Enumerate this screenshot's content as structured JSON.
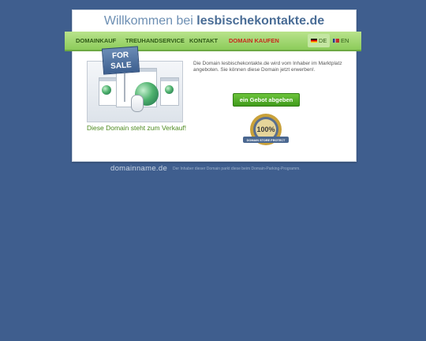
{
  "header": {
    "title_prefix": "Willkommen bei",
    "domain": "lesbischekontakte.de"
  },
  "nav": {
    "items": [
      {
        "label": "Domainkauf"
      },
      {
        "label": "Treuhandservice"
      },
      {
        "label": "Kontakt"
      },
      {
        "label": "Domain kaufen"
      }
    ],
    "languages": [
      {
        "code": "DE",
        "active": true
      },
      {
        "code": "EN",
        "active": false
      }
    ]
  },
  "sale": {
    "sign_line1": "FOR",
    "sign_line2": "SALE",
    "caption": "Diese Domain steht zum Verkauf!"
  },
  "info": {
    "text": "Die Domain lesbischekontakte.de wird vom Inhaber im Marktplatz angeboten. Sie können diese Domain jetzt erwerben!."
  },
  "bid_button": {
    "label": "ein Gebot abgeben"
  },
  "seal": {
    "big": "100%",
    "ribbon": "DOMAIN STORE PROTECT"
  },
  "footer": {
    "logo": "domainname.de",
    "text": "Der Inhaber dieser Domain parkt diese beim Domain-Parking-Programm."
  },
  "colors": {
    "background": "#3f5e8e",
    "nav_green": "#8ccc5a",
    "button_green": "#3f9a1b",
    "caption_green": "#4d8a1f",
    "nav_red": "#c8281e"
  }
}
